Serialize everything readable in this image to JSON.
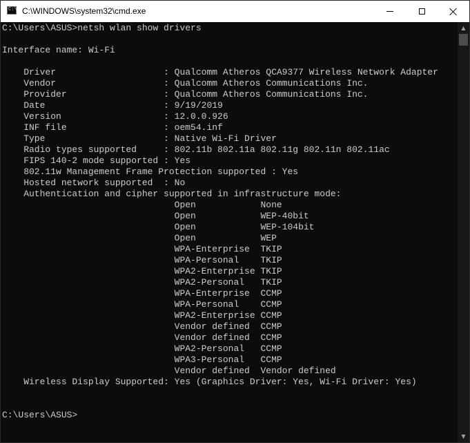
{
  "window": {
    "title": "C:\\WINDOWS\\system32\\cmd.exe",
    "icon": "cmd-console-icon",
    "icon_text": "C:\\",
    "controls": {
      "minimize": "minimize-icon",
      "maximize": "maximize-icon",
      "close": "close-icon"
    }
  },
  "console": {
    "lines": [
      "C:\\Users\\ASUS>netsh wlan show drivers",
      "",
      "Interface name: Wi-Fi",
      "",
      "    Driver                    : Qualcomm Atheros QCA9377 Wireless Network Adapter",
      "    Vendor                    : Qualcomm Atheros Communications Inc.",
      "    Provider                  : Qualcomm Atheros Communications Inc.",
      "    Date                      : 9/19/2019",
      "    Version                   : 12.0.0.926",
      "    INF file                  : oem54.inf",
      "    Type                      : Native Wi-Fi Driver",
      "    Radio types supported     : 802.11b 802.11a 802.11g 802.11n 802.11ac",
      "    FIPS 140-2 mode supported : Yes",
      "    802.11w Management Frame Protection supported : Yes",
      "    Hosted network supported  : No",
      "    Authentication and cipher supported in infrastructure mode:",
      "                                Open            None",
      "                                Open            WEP-40bit",
      "                                Open            WEP-104bit",
      "                                Open            WEP",
      "                                WPA-Enterprise  TKIP",
      "                                WPA-Personal    TKIP",
      "                                WPA2-Enterprise TKIP",
      "                                WPA2-Personal   TKIP",
      "                                WPA-Enterprise  CCMP",
      "                                WPA-Personal    CCMP",
      "                                WPA2-Enterprise CCMP",
      "                                Vendor defined  CCMP",
      "                                Vendor defined  CCMP",
      "                                WPA2-Personal   CCMP",
      "                                WPA3-Personal   CCMP",
      "                                Vendor defined  Vendor defined",
      "    Wireless Display Supported: Yes (Graphics Driver: Yes, Wi-Fi Driver: Yes)",
      "",
      "",
      "C:\\Users\\ASUS>"
    ]
  },
  "scrollbar": {
    "up": "scroll-up-icon",
    "down": "scroll-down-icon"
  },
  "colors": {
    "background": "#0c0c0c",
    "text": "#cccccc",
    "titlebar": "#ffffff"
  }
}
